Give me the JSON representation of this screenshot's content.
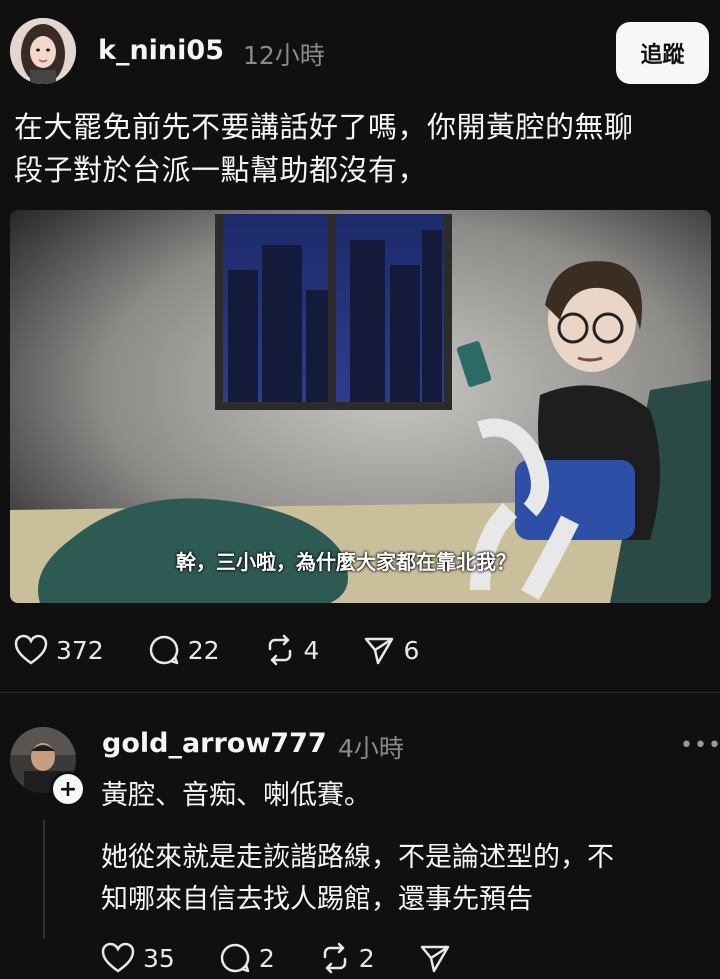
{
  "post": {
    "username": "k_nini05",
    "time": "12小時",
    "follow_label": "追蹤",
    "text_line1": "在大罷免前先不要講話好了嗎，你開黃腔的無聊",
    "text_line2": "段子對於台派一點幫助都沒有，",
    "media_caption": "幹，三小啦，為什麼大家都在靠北我？",
    "likes": "372",
    "comments": "22",
    "reposts": "4",
    "shares": "6"
  },
  "reply": {
    "username": "gold_arrow777",
    "time": "4小時",
    "more_label": "•••",
    "follow_plus": "+",
    "text_line1": "黃腔、音痴、喇低賽。",
    "text_line2": "她從來就是走詼諧路線，不是論述型的，不",
    "text_line3": "知哪來自信去找人踢館，還事先預告",
    "likes": "35",
    "comments": "2",
    "reposts": "2"
  },
  "icons": {
    "like": "heart-icon",
    "comment": "speech-bubble-icon",
    "repost": "repost-icon",
    "share": "paper-plane-icon"
  }
}
